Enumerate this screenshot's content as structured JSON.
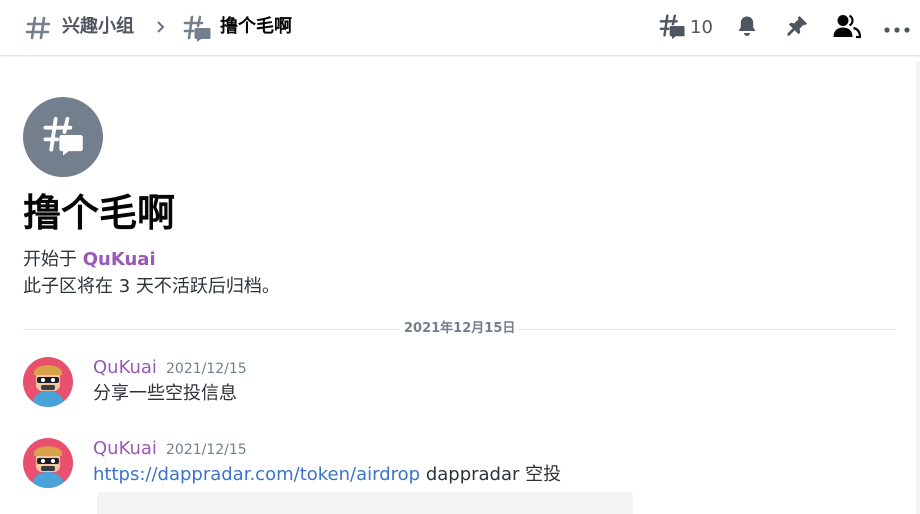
{
  "header": {
    "parent_channel": "兴趣小组",
    "thread_name": "撸个毛啊",
    "thread_count": "10",
    "icons": [
      "channel-hash-icon",
      "chevron-right-icon",
      "thread-icon",
      "threads-icon",
      "bell-icon",
      "pin-icon",
      "members-icon",
      "more-icon"
    ]
  },
  "thread": {
    "title": "撸个毛啊",
    "started_prefix": "开始于",
    "started_by": "QuKuai",
    "archive_note": "此子区将在 3 天不活跃后归档。"
  },
  "divider": {
    "date": "2021年12月15日"
  },
  "messages": [
    {
      "author": "QuKuai",
      "timestamp": "2021/12/15",
      "text": "分享一些空投信息"
    },
    {
      "author": "QuKuai",
      "timestamp": "2021/12/15",
      "link": "https://dappradar.com/token/airdrop",
      "text": "dappradar 空投"
    }
  ],
  "colors": {
    "username": "#9b59b6",
    "link": "#3b74c9",
    "thread_avatar_bg": "#747f8d",
    "user_avatar_bg": "#e8506e"
  }
}
